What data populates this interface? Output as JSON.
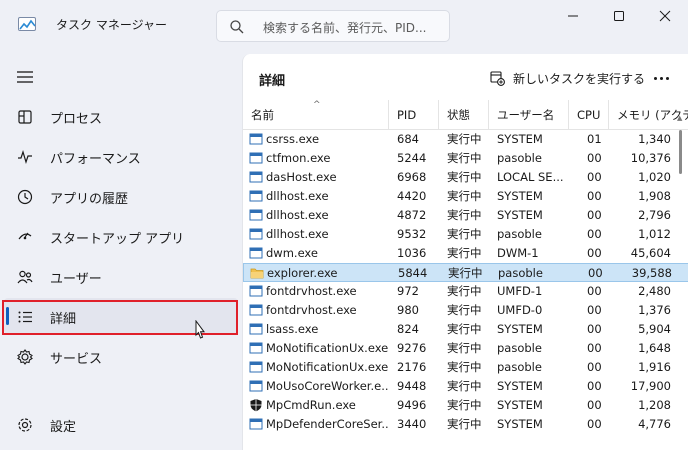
{
  "window": {
    "title": "タスク マネージャー",
    "search_placeholder": "検索する名前、発行元、PID...",
    "minimize_icon": "minimize-icon",
    "maximize_icon": "maximize-icon",
    "close_icon": "close-icon"
  },
  "sidebar": {
    "menu_icon": "hamburger-icon",
    "items": [
      {
        "label": "プロセス",
        "icon": "processes-icon"
      },
      {
        "label": "パフォーマンス",
        "icon": "performance-icon"
      },
      {
        "label": "アプリの履歴",
        "icon": "history-icon"
      },
      {
        "label": "スタートアップ アプリ",
        "icon": "startup-icon"
      },
      {
        "label": "ユーザー",
        "icon": "users-icon"
      },
      {
        "label": "詳細",
        "icon": "details-icon",
        "active": true
      },
      {
        "label": "サービス",
        "icon": "services-icon"
      }
    ],
    "settings": {
      "label": "設定",
      "icon": "gear-icon"
    }
  },
  "main": {
    "title": "詳細",
    "new_task_label": "新しいタスクを実行する",
    "columns": [
      "名前",
      "PID",
      "状態",
      "ユーザー名",
      "CPU",
      "メモリ (アクテ"
    ],
    "rows": [
      {
        "name": "csrss.exe",
        "pid": "684",
        "status": "実行中",
        "user": "SYSTEM",
        "cpu": "01",
        "mem": "1,340"
      },
      {
        "name": "ctfmon.exe",
        "pid": "5244",
        "status": "実行中",
        "user": "pasoble",
        "cpu": "00",
        "mem": "10,376"
      },
      {
        "name": "dasHost.exe",
        "pid": "6968",
        "status": "実行中",
        "user": "LOCAL SE...",
        "cpu": "00",
        "mem": "1,020"
      },
      {
        "name": "dllhost.exe",
        "pid": "4420",
        "status": "実行中",
        "user": "SYSTEM",
        "cpu": "00",
        "mem": "1,908"
      },
      {
        "name": "dllhost.exe",
        "pid": "4872",
        "status": "実行中",
        "user": "SYSTEM",
        "cpu": "00",
        "mem": "2,796"
      },
      {
        "name": "dllhost.exe",
        "pid": "9532",
        "status": "実行中",
        "user": "pasoble",
        "cpu": "00",
        "mem": "1,012"
      },
      {
        "name": "dwm.exe",
        "pid": "1036",
        "status": "実行中",
        "user": "DWM-1",
        "cpu": "00",
        "mem": "45,604"
      },
      {
        "name": "explorer.exe",
        "pid": "5844",
        "status": "実行中",
        "user": "pasoble",
        "cpu": "00",
        "mem": "39,588",
        "selected": true,
        "icon": "folder-icon"
      },
      {
        "name": "fontdrvhost.exe",
        "pid": "972",
        "status": "実行中",
        "user": "UMFD-1",
        "cpu": "00",
        "mem": "2,480"
      },
      {
        "name": "fontdrvhost.exe",
        "pid": "980",
        "status": "実行中",
        "user": "UMFD-0",
        "cpu": "00",
        "mem": "1,376"
      },
      {
        "name": "lsass.exe",
        "pid": "824",
        "status": "実行中",
        "user": "SYSTEM",
        "cpu": "00",
        "mem": "5,904"
      },
      {
        "name": "MoNotificationUx.exe",
        "pid": "9276",
        "status": "実行中",
        "user": "pasoble",
        "cpu": "00",
        "mem": "1,648"
      },
      {
        "name": "MoNotificationUx.exe",
        "pid": "2176",
        "status": "実行中",
        "user": "pasoble",
        "cpu": "00",
        "mem": "1,916"
      },
      {
        "name": "MoUsoCoreWorker.e...",
        "pid": "9448",
        "status": "実行中",
        "user": "SYSTEM",
        "cpu": "00",
        "mem": "17,900"
      },
      {
        "name": "MpCmdRun.exe",
        "pid": "9496",
        "status": "実行中",
        "user": "SYSTEM",
        "cpu": "00",
        "mem": "1,208",
        "icon": "shield-icon"
      },
      {
        "name": "MpDefenderCoreSer...",
        "pid": "3440",
        "status": "実行中",
        "user": "SYSTEM",
        "cpu": "00",
        "mem": "4,776"
      }
    ]
  },
  "colors": {
    "accent": "#0f5fbd",
    "selected_row": "#cce4f7",
    "highlight_box": "#e0202a"
  }
}
